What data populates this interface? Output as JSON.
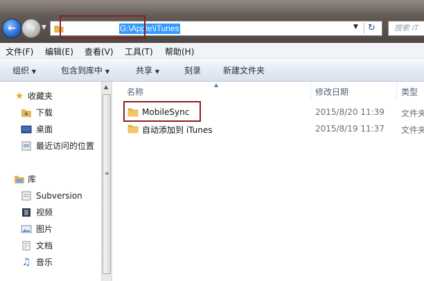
{
  "window": {
    "address_path": "G:\\Apple\\iTunes",
    "search_placeholder": "搜索 iT"
  },
  "menu": {
    "items": [
      "文件(F)",
      "编辑(E)",
      "查看(V)",
      "工具(T)",
      "帮助(H)"
    ]
  },
  "toolbar": {
    "organize": "组织",
    "include_in_library": "包含到库中",
    "share": "共享",
    "burn": "刻录",
    "new_folder": "新建文件夹"
  },
  "nav_pane": {
    "favorites_label": "收藏夹",
    "favorites": [
      "下载",
      "桌面",
      "最近访问的位置"
    ],
    "libraries_label": "库",
    "libraries": [
      "Subversion",
      "视频",
      "图片",
      "文档",
      "音乐"
    ]
  },
  "columns": {
    "name": "名称",
    "date_modified": "修改日期",
    "type": "类型"
  },
  "files": [
    {
      "name": "MobileSync",
      "date": "2015/8/20 11:39",
      "type": "文件夹"
    },
    {
      "name": "自动添加到 iTunes",
      "date": "2015/8/19 11:37",
      "type": "文件夹"
    }
  ],
  "colors": {
    "highlight": "#3399ff",
    "annotation_box": "#8c1c23",
    "folder": "#e8b84a"
  },
  "icons": [
    "back-arrow-icon",
    "forward-arrow-icon",
    "folder-icon",
    "refresh-icon",
    "star-icon",
    "library-icon"
  ]
}
